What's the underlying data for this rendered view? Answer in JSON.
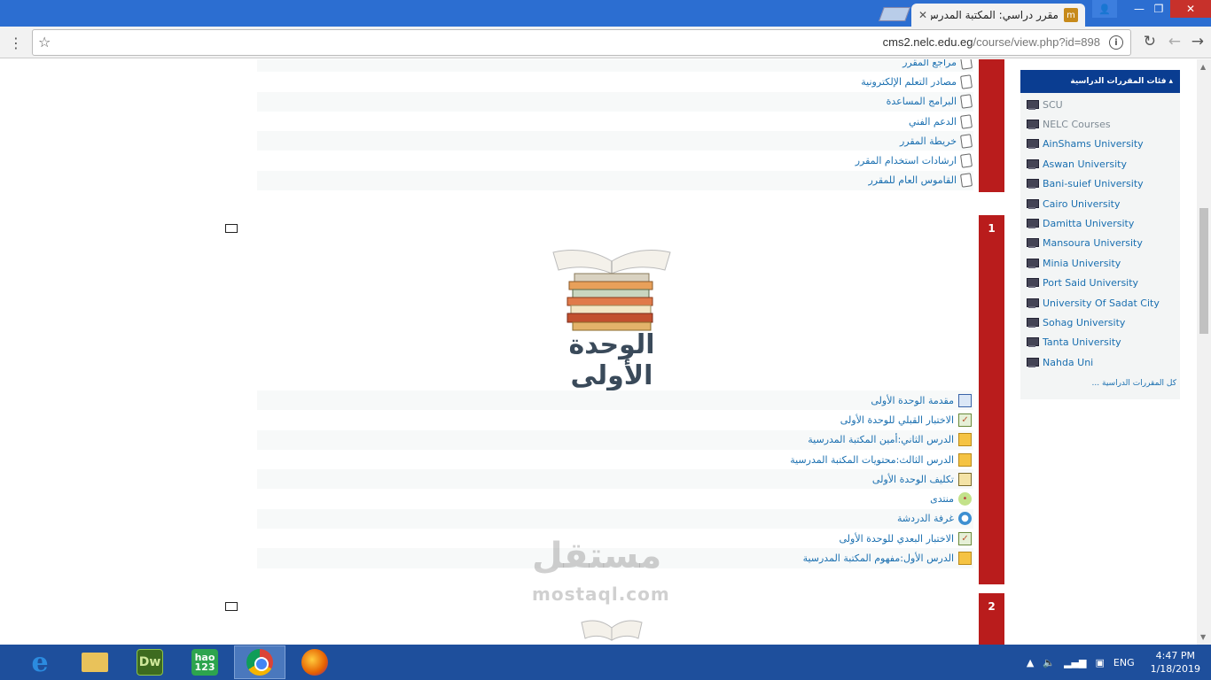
{
  "browser": {
    "tab_title": "مقرر دراسي: المكتبة المدرس",
    "url_host": "cms2.nelc.edu.eg",
    "url_path": "/course/view.php?id=898"
  },
  "section0": {
    "items": [
      {
        "label": "مراجع المقرر",
        "icon": "document-icon"
      },
      {
        "label": "مصادر التعلم الإلكترونية",
        "icon": "document-icon"
      },
      {
        "label": "البرامج المساعدة",
        "icon": "document-icon"
      },
      {
        "label": "الدعم الفني",
        "icon": "document-icon"
      },
      {
        "label": "خريطة المقرر",
        "icon": "document-icon"
      },
      {
        "label": "ارشادات استخدام المقرر",
        "icon": "document-icon"
      },
      {
        "label": "القاموس العام للمقرر",
        "icon": "document-icon"
      }
    ]
  },
  "section1": {
    "number": "1",
    "title": "الوحدة الأولى",
    "items": [
      {
        "label": "مقدمة الوحدة الأولى",
        "icon": "page-icon"
      },
      {
        "label": "الاختبار القبلي للوحدة الأولى",
        "icon": "quiz-icon"
      },
      {
        "label": "الدرس الثاني:أمين المكتبة المدرسية",
        "icon": "lesson-icon"
      },
      {
        "label": "الدرس الثالث:محتويات المكتبة المدرسية",
        "icon": "lesson-icon"
      },
      {
        "label": "تكليف الوحدة الأولى",
        "icon": "assignment-icon"
      },
      {
        "label": "منتدى",
        "icon": "forum-icon"
      },
      {
        "label": "غرفة الدردشة",
        "icon": "chat-icon"
      },
      {
        "label": "الاختبار البعدي للوحدة الأولى",
        "icon": "quiz-icon"
      },
      {
        "label": "الدرس الأول:مفهوم المكتبة المدرسية",
        "icon": "lesson-icon"
      }
    ]
  },
  "section2": {
    "number": "2"
  },
  "sidebar": {
    "title": "فئات المقررات الدراسية",
    "universities": [
      "SCU",
      "NELC Courses",
      "AinShams University",
      "Aswan University",
      "Bani-suief University",
      "Cairo University",
      "Damitta University",
      "Mansoura University",
      "Minia University",
      "Port Said University",
      "University Of Sadat City",
      "Sohag University",
      "Tanta University",
      "Nahda Uni"
    ],
    "all_courses": "كل المقررات الدراسية ..."
  },
  "watermark": {
    "arabic": "مستقل",
    "latin": "mostaql.com"
  },
  "taskbar": {
    "apps": [
      "ie-icon",
      "file-explorer-icon",
      "dreamweaver-icon",
      "hao123-icon",
      "chrome-icon",
      "firefox-icon"
    ],
    "dw_label": "Dw",
    "hao_label": "hao 123",
    "language": "ENG",
    "time": "4:47 PM",
    "date": "1/18/2019"
  }
}
